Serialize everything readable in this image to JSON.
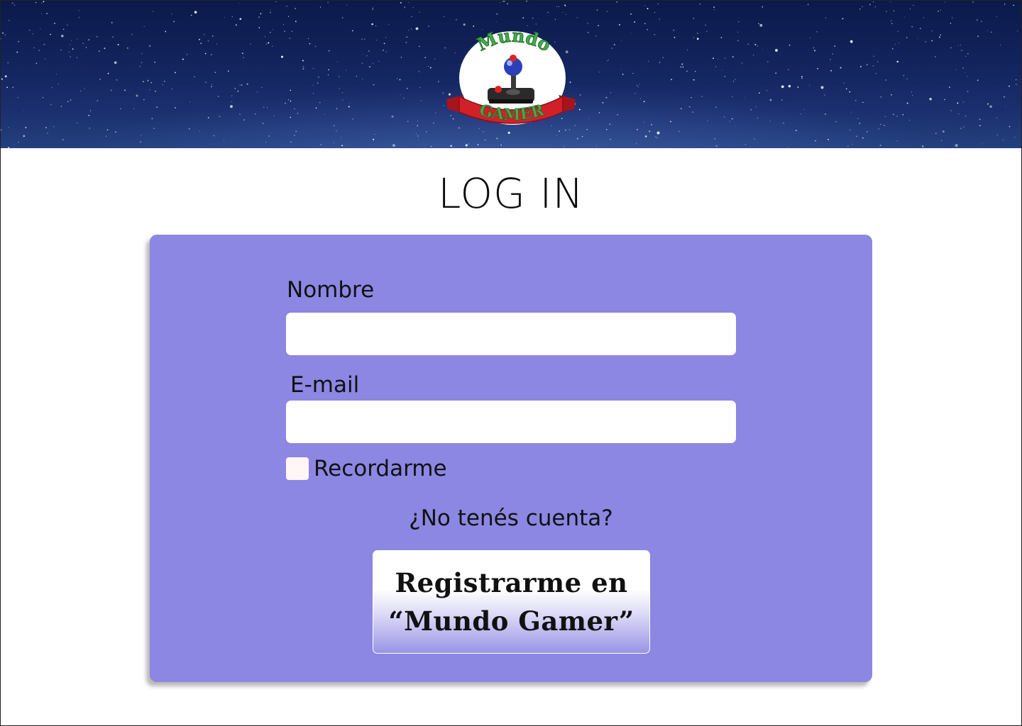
{
  "logo": {
    "top_text": "Mundo",
    "banner_text": "GAMER",
    "icon": "joystick-icon"
  },
  "page": {
    "title": "LOG IN"
  },
  "form": {
    "name_label": "Nombre",
    "name_value": "",
    "email_label": "E-mail",
    "email_value": "",
    "remember_label": "Recordarme",
    "remember_checked": false,
    "no_account_text": "¿No tenés cuenta?",
    "register_button_line1": "Registrarme en",
    "register_button_line2": "“Mundo Gamer”"
  },
  "colors": {
    "card_background": "#8c87e2",
    "header_sky": "#13245e",
    "logo_banner_red": "#d2202a",
    "logo_text_green": "#3fae49"
  }
}
